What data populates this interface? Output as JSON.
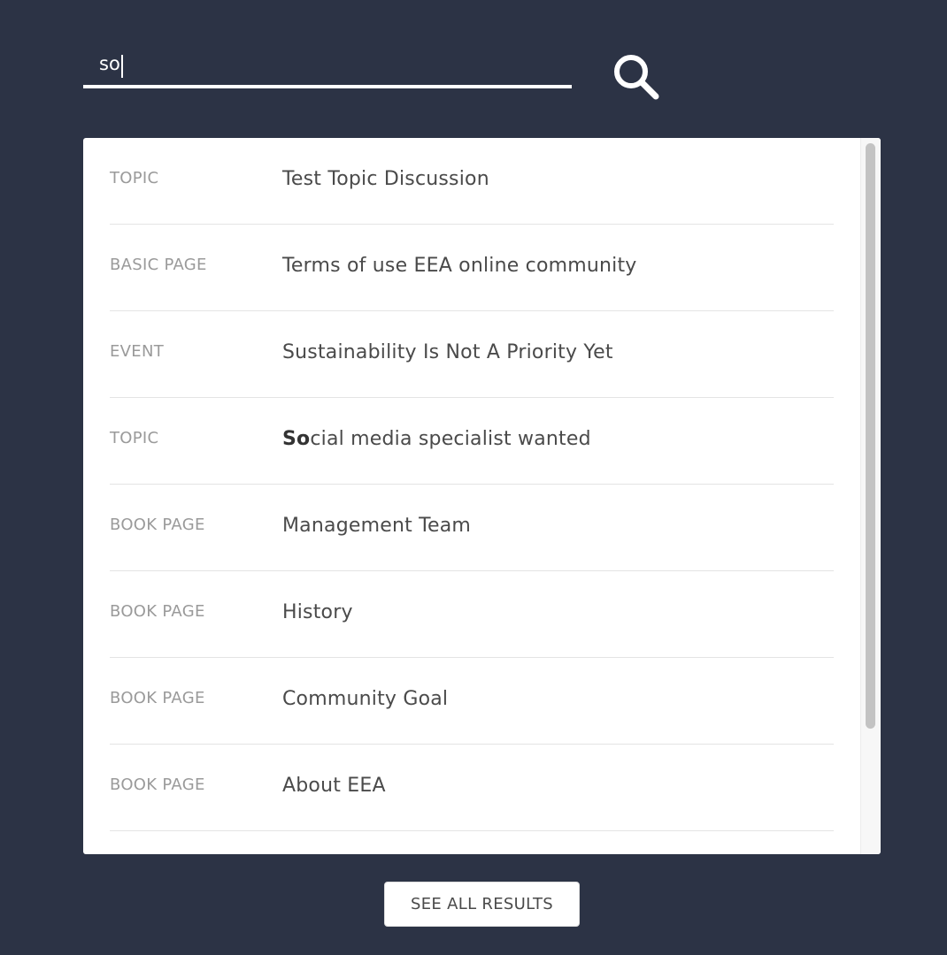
{
  "search": {
    "value": "so",
    "button_icon": "search-icon"
  },
  "results": [
    {
      "type": "TOPIC",
      "title_bold": "",
      "title_rest": "Test Topic Discussion"
    },
    {
      "type": "BASIC PAGE",
      "title_bold": "",
      "title_rest": "Terms of use EEA online community"
    },
    {
      "type": "EVENT",
      "title_bold": "",
      "title_rest": "Sustainability Is Not A Priority Yet"
    },
    {
      "type": "TOPIC",
      "title_bold": "So",
      "title_rest": "cial media specialist wanted"
    },
    {
      "type": "BOOK PAGE",
      "title_bold": "",
      "title_rest": "Management Team"
    },
    {
      "type": "BOOK PAGE",
      "title_bold": "",
      "title_rest": "History"
    },
    {
      "type": "BOOK PAGE",
      "title_bold": "",
      "title_rest": "Community Goal"
    },
    {
      "type": "BOOK PAGE",
      "title_bold": "",
      "title_rest": "About EEA"
    }
  ],
  "see_all_label": "SEE ALL RESULTS",
  "colors": {
    "background": "#2c3345",
    "panel": "#ffffff",
    "type_text": "#9a9a9a",
    "title_text": "#4a4a4a"
  }
}
